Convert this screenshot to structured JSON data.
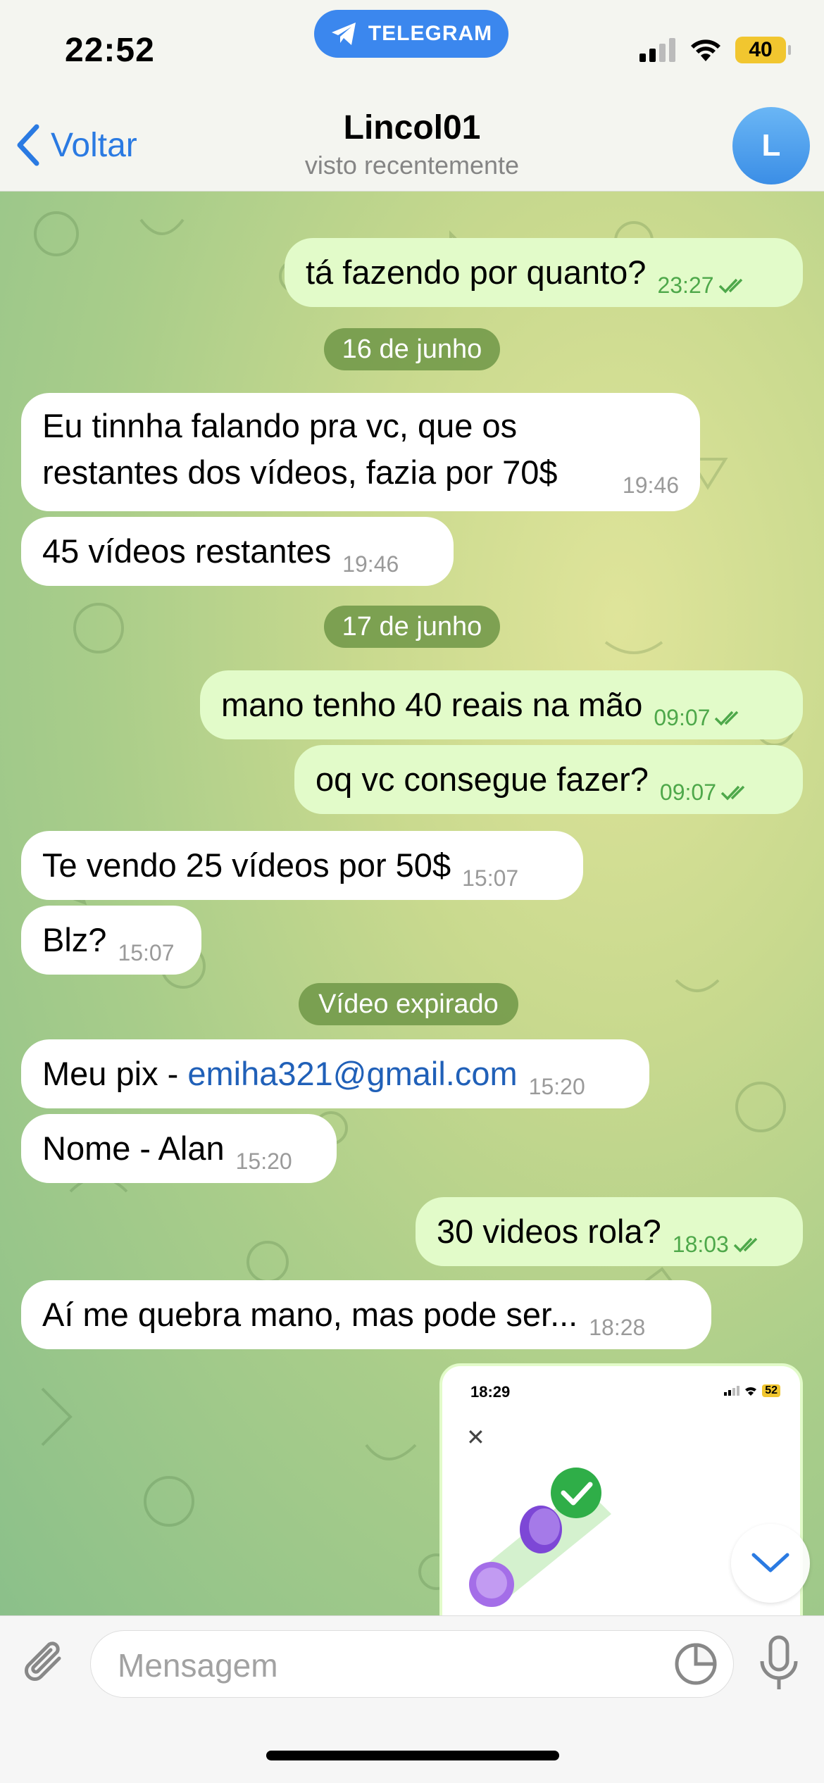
{
  "status_bar": {
    "time": "22:52",
    "app_pill": "TELEGRAM",
    "battery": "40"
  },
  "header": {
    "back_label": "Voltar",
    "title": "Lincol01",
    "subtitle": "visto recentemente",
    "avatar_letter": "L"
  },
  "messages": [
    {
      "dir": "out",
      "text": "tá fazendo por quanto?",
      "time": "23:27",
      "read": true
    },
    {
      "type": "date",
      "text": "16 de junho"
    },
    {
      "dir": "in",
      "lines": [
        "Eu tinnha falando pra vc, que os",
        "restantes dos vídeos, fazia por 70$"
      ],
      "time": "19:46"
    },
    {
      "dir": "in",
      "text": "45 vídeos restantes",
      "time": "19:46"
    },
    {
      "type": "date",
      "text": "17 de junho"
    },
    {
      "dir": "out",
      "text": "mano tenho 40 reais na mão",
      "time": "09:07",
      "read": true
    },
    {
      "dir": "out",
      "text": "oq vc consegue fazer?",
      "time": "09:07",
      "read": true
    },
    {
      "dir": "in",
      "text": "Te vendo 25 vídeos por 50$",
      "time": "15:07"
    },
    {
      "dir": "in",
      "text": "Blz?",
      "time": "15:07"
    },
    {
      "type": "date",
      "text": "Vídeo expirado"
    },
    {
      "dir": "in",
      "prefix": "Meu pix - ",
      "link": "emiha321@gmail.com",
      "time": "15:20"
    },
    {
      "dir": "in",
      "text": "Nome - Alan",
      "time": "15:20"
    },
    {
      "dir": "out",
      "text": "30 videos rola?",
      "time": "18:03",
      "read": true
    },
    {
      "dir": "in",
      "text": "Aí me quebra mano, mas pode ser...",
      "time": "18:28"
    }
  ],
  "image_message": {
    "time": "18:29",
    "battery": "52"
  },
  "composer": {
    "placeholder": "Mensagem"
  },
  "colors": {
    "accent": "#2a7ae2",
    "outgoing_bubble": "#e2fbc9",
    "incoming_bubble": "#ffffff",
    "read_check": "#4ea84a"
  }
}
